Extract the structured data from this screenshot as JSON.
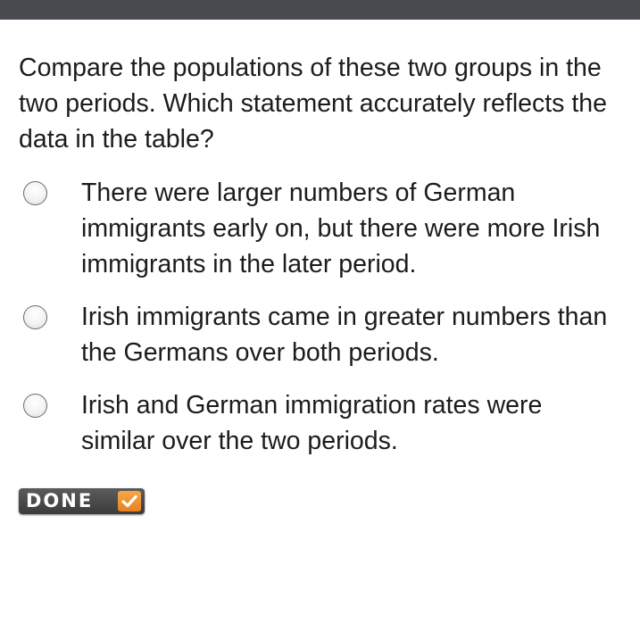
{
  "question": {
    "text": "Compare the populations of these two groups in the two periods. Which statement accurately reflects the data in the table?"
  },
  "options": [
    {
      "label": "There were larger numbers of German immigrants early on, but there were more Irish immigrants in the later period.",
      "selected": false
    },
    {
      "label": "Irish immigrants came in greater numbers than the Germans over both periods.",
      "selected": false
    },
    {
      "label": "Irish and German immigration rates were similar over the two periods.",
      "selected": false
    }
  ],
  "done_button": {
    "label": "DONE",
    "icon": "checkmark-icon"
  },
  "colors": {
    "top_bar": "#4a4b50",
    "done_bg": "#4a4a4a",
    "done_check": "#f0922e",
    "text": "#1c1c1c"
  }
}
